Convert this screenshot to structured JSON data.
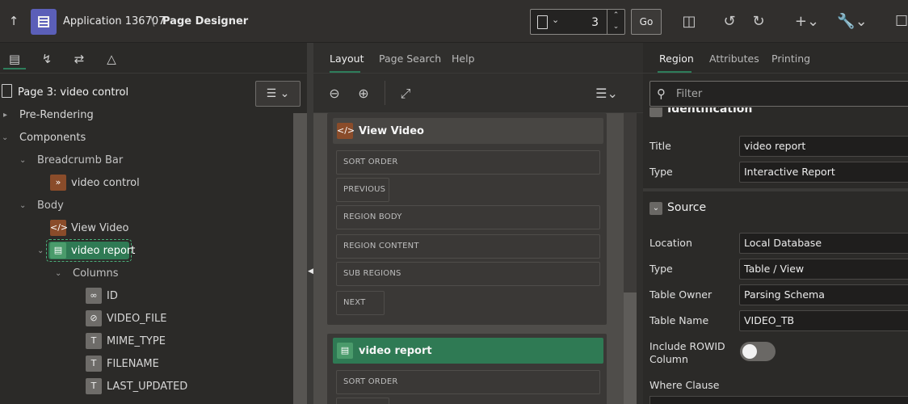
{
  "topbar": {
    "app_name": "Application 136707",
    "separator": "\\",
    "title": "Page Designer",
    "page_number": "3",
    "go_label": "Go"
  },
  "left": {
    "page_header": "Page 3: video control",
    "tree": {
      "pre_rendering": "Pre-Rendering",
      "components": "Components",
      "breadcrumb_bar": "Breadcrumb Bar",
      "breadcrumb_item": "video control",
      "body": "Body",
      "view_video": "View Video",
      "video_report": "video report",
      "columns": "Columns",
      "cols": [
        "ID",
        "VIDEO_FILE",
        "MIME_TYPE",
        "FILENAME",
        "LAST_UPDATED"
      ]
    }
  },
  "middle": {
    "tabs": [
      "Layout",
      "Page Search",
      "Help"
    ],
    "region1_title": "View Video",
    "region1_slots": [
      "SORT ORDER",
      "PREVIOUS",
      "REGION BODY",
      "REGION CONTENT",
      "SUB REGIONS",
      "NEXT"
    ],
    "region2_title": "video report",
    "region2_slots": [
      "SORT ORDER"
    ]
  },
  "right": {
    "tabs": [
      "Region",
      "Attributes",
      "Printing"
    ],
    "filter_placeholder": "Filter",
    "identification_label": "Identification",
    "title_label": "Title",
    "title_value": "video report",
    "type_label": "Type",
    "type_value": "Interactive Report",
    "source_header": "Source",
    "location_label": "Location",
    "location_value": "Local Database",
    "src_type_label": "Type",
    "src_type_value": "Table / View",
    "owner_label": "Table Owner",
    "owner_value": "Parsing Schema",
    "table_name_label": "Table Name",
    "table_name_value": "VIDEO_TB",
    "rowid_label_1": "Include ROWID",
    "rowid_label_2": "Column",
    "where_label": "Where Clause"
  }
}
